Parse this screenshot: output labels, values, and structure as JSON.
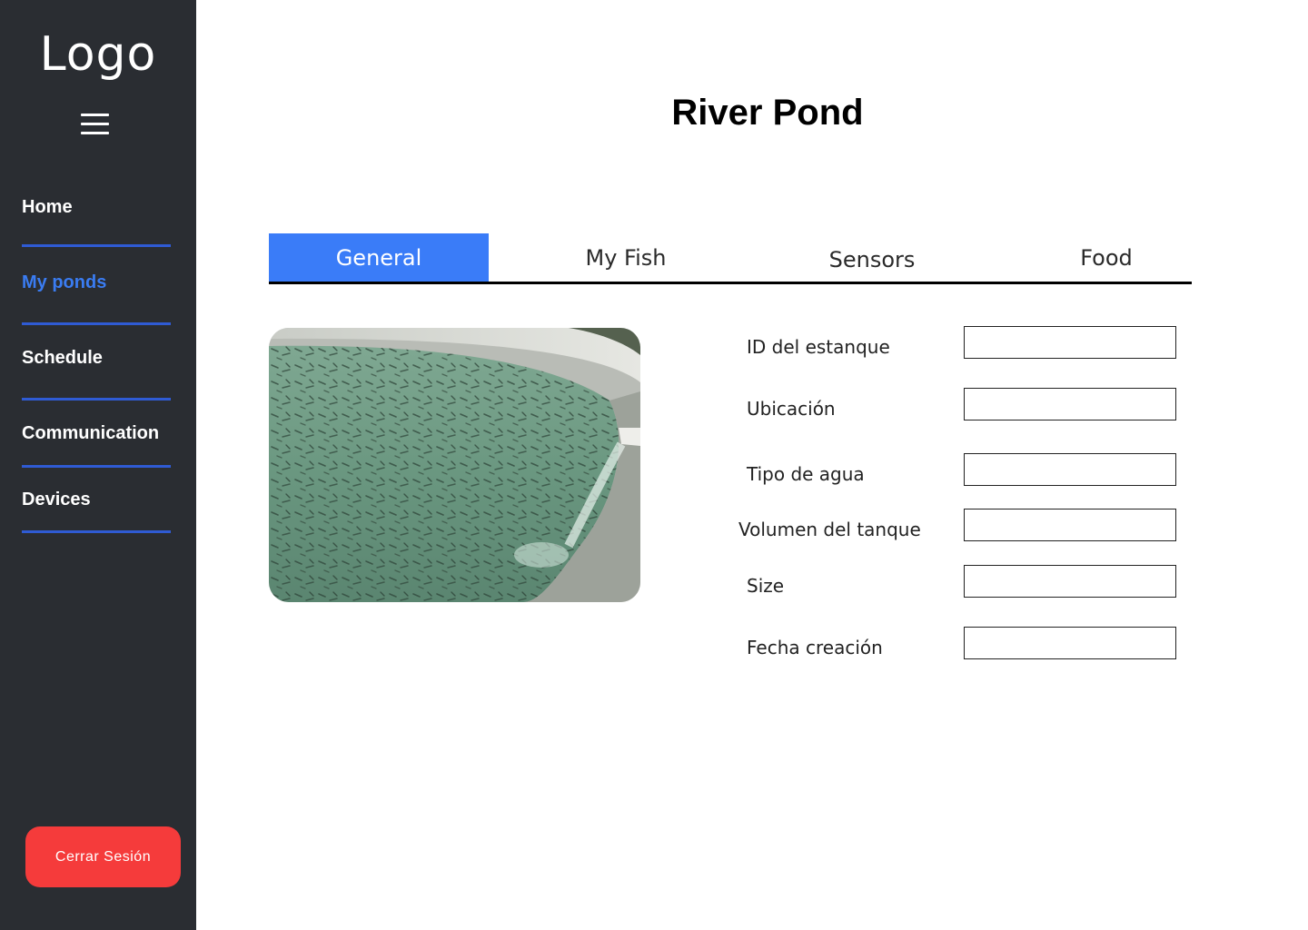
{
  "sidebar": {
    "logo": "Logo",
    "menu_icon": "hamburger-menu-icon",
    "nav": [
      {
        "label": "Home",
        "active": false
      },
      {
        "label": "My ponds",
        "active": true
      },
      {
        "label": "Schedule",
        "active": false
      },
      {
        "label": "Communication",
        "active": false
      },
      {
        "label": "Devices",
        "active": false
      }
    ],
    "logout_label": "Cerrar Sesión"
  },
  "main": {
    "title": "River Pond",
    "tabs": [
      {
        "label": "General",
        "active": true
      },
      {
        "label": "My Fish",
        "active": false
      },
      {
        "label": "Sensors",
        "active": false
      },
      {
        "label": "Food",
        "active": false
      }
    ],
    "fields": [
      {
        "label": "ID del estanque",
        "value": ""
      },
      {
        "label": "Ubicación",
        "value": ""
      },
      {
        "label": "Tipo de agua",
        "value": ""
      },
      {
        "label": "Volumen del tanque",
        "value": ""
      },
      {
        "label": "Size",
        "value": ""
      },
      {
        "label": "Fecha creación",
        "value": ""
      }
    ]
  },
  "colors": {
    "sidebar_bg": "#2a2d32",
    "accent": "#3a7cf8",
    "nav_divider": "#2f5bd4",
    "logout_bg": "#f53b3b"
  }
}
